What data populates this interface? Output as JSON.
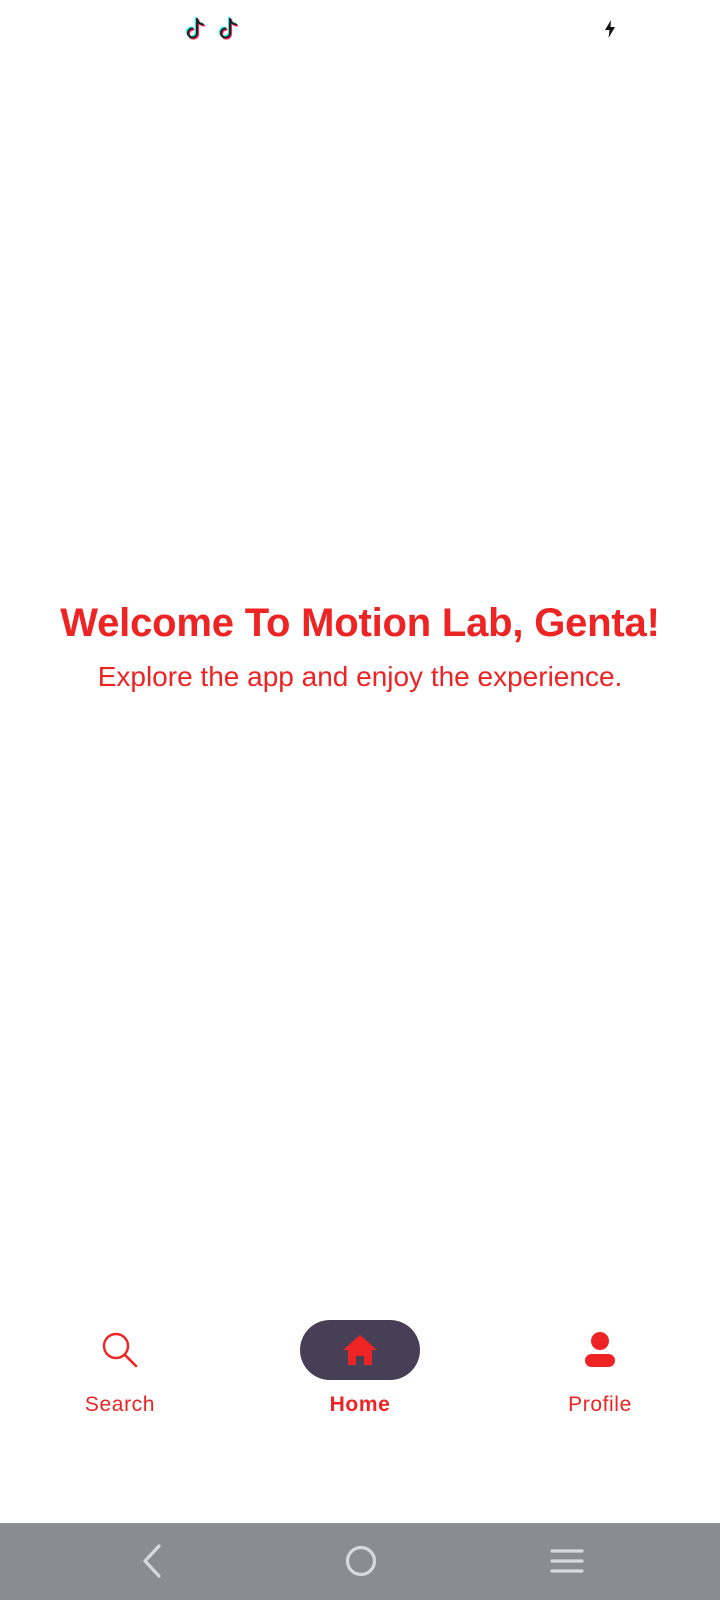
{
  "status_bar": {
    "notification_icons": [
      "tiktok-icon",
      "tiktok-icon"
    ],
    "right_icon": "charging-bolt-icon"
  },
  "welcome": {
    "title": "Welcome To Motion Lab, Genta!",
    "subtitle": "Explore the app and enjoy the experience."
  },
  "bottom_nav": {
    "items": [
      {
        "label": "Search",
        "icon": "search-icon",
        "active": false
      },
      {
        "label": "Home",
        "icon": "home-icon",
        "active": true
      },
      {
        "label": "Profile",
        "icon": "profile-icon",
        "active": false
      }
    ]
  },
  "system_nav": {
    "buttons": [
      "back-icon",
      "home-circle-icon",
      "recents-icon"
    ]
  },
  "colors": {
    "accent": "#ee2323",
    "active_pill": "#473f55",
    "system_nav_bg": "#8b8c90",
    "background": "#ffffff"
  }
}
